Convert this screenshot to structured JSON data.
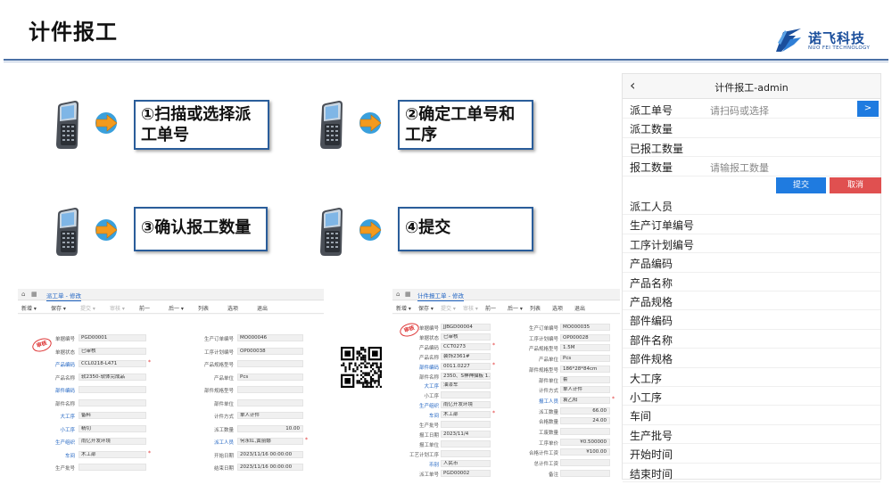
{
  "slide": {
    "title": "计件报工",
    "logo_name": "诺飞科技",
    "logo_sub": "NUO FEI TECHNOLOGY"
  },
  "steps": [
    {
      "label_line1": "①扫描或选择派",
      "label_line2": "工单号"
    },
    {
      "label_line1": "②确定工单号和",
      "label_line2": "工序"
    },
    {
      "label_line1": "③确认报工数量",
      "label_line2": ""
    },
    {
      "label_line1": "④提交",
      "label_line2": ""
    }
  ],
  "colors": {
    "accent": "#2a5d9a",
    "arrow": "#f39a1e",
    "primary_btn": "#1f7be0",
    "danger_btn": "#e05050"
  },
  "shot_left": {
    "tab": "派工单 - 修改",
    "toolbar": [
      "新增",
      "保存",
      "提交",
      "审核",
      "前一",
      "后一",
      "列表",
      "选项",
      "退出"
    ],
    "stamp": "审核",
    "left_fields": [
      {
        "label": "单据编号",
        "value": "PGD00001"
      },
      {
        "label": "单据状态",
        "value": "已审核"
      },
      {
        "label": "产品编码",
        "value": "CCL0218-L471"
      },
      {
        "label": "产品名称",
        "value": "软2350-软体完成品"
      },
      {
        "label": "部件编码",
        "value": ""
      },
      {
        "label": "部件名称",
        "value": ""
      },
      {
        "label": "大工序",
        "value": "备料"
      },
      {
        "label": "小工序",
        "value": "精切"
      },
      {
        "label": "生产组织",
        "value": "雨亿开发环境"
      },
      {
        "label": "车间",
        "value": "木工部"
      },
      {
        "label": "生产批号",
        "value": ""
      }
    ],
    "right_fields": [
      {
        "label": "生产订单编号",
        "value": "MO000046"
      },
      {
        "label": "工序计划编号",
        "value": "OP000038"
      },
      {
        "label": "产品规格型号",
        "value": ""
      },
      {
        "label": "产品单位",
        "value": "Pcs"
      },
      {
        "label": "部件规格型号",
        "value": ""
      },
      {
        "label": "部件单位",
        "value": ""
      },
      {
        "label": "计件方式",
        "value": "单人计件"
      },
      {
        "label": "派工数量",
        "value": "10.00"
      },
      {
        "label": "派工人员",
        "value": "何永红,黄丽娜"
      },
      {
        "label": "开始日期",
        "value": "2023/11/16 00:00:00"
      },
      {
        "label": "结束日期",
        "value": "2023/11/16 00:00:00"
      }
    ]
  },
  "shot_right": {
    "tab": "计件报工单 - 修改",
    "toolbar": [
      "新增",
      "保存",
      "提交",
      "审核",
      "前一",
      "后一",
      "列表",
      "选项",
      "退出"
    ],
    "stamp": "审核",
    "left_fields": [
      {
        "label": "单据编号",
        "value": "JJBGD00004"
      },
      {
        "label": "单据状态",
        "value": "已审核"
      },
      {
        "label": "产品编码",
        "value": "CCT0273"
      },
      {
        "label": "产品名称",
        "value": "装饰2361#"
      },
      {
        "label": "部件编码",
        "value": "0011.0227"
      },
      {
        "label": "部件名称",
        "value": "2350、S神神描板 1.8M"
      },
      {
        "label": "大工序",
        "value": "油漆车"
      },
      {
        "label": "小工序",
        "value": ""
      },
      {
        "label": "生产组织",
        "value": "雨亿开发环境"
      },
      {
        "label": "车间",
        "value": "木工部"
      },
      {
        "label": "生产批号",
        "value": ""
      },
      {
        "label": "报工日期",
        "value": "2023/11/4"
      },
      {
        "label": "报工单位",
        "value": ""
      },
      {
        "label": "工艺计划工序",
        "value": ""
      },
      {
        "label": "币别",
        "value": "人民币"
      },
      {
        "label": "派工单号",
        "value": "PGD00002"
      }
    ],
    "right_fields": [
      {
        "label": "生产订单编号",
        "value": "MO000035"
      },
      {
        "label": "工序计划编号",
        "value": "OP000028"
      },
      {
        "label": "产品规格型号",
        "value": "1.5M"
      },
      {
        "label": "产品单位",
        "value": "Pcs"
      },
      {
        "label": "部件规格型号",
        "value": "186*28*84cm"
      },
      {
        "label": "部件单位",
        "value": "套"
      },
      {
        "label": "计件方式",
        "value": "单人计件"
      },
      {
        "label": "报工人员",
        "value": "袁乙阳"
      },
      {
        "label": "派工数量",
        "value": "66.00"
      },
      {
        "label": "合格数量",
        "value": "24.00"
      },
      {
        "label": "工废数量",
        "value": ""
      },
      {
        "label": "工序单价",
        "value": "¥0.500000"
      },
      {
        "label": "合格计件工资",
        "value": "¥100.00"
      },
      {
        "label": "总计件工资",
        "value": ""
      },
      {
        "label": "备注",
        "value": ""
      }
    ]
  },
  "mobile": {
    "title": "计件报工-admin",
    "back": "‹",
    "rows": [
      {
        "label": "派工单号",
        "placeholder": "请扫码或选择",
        "scan": ">"
      },
      {
        "label": "派工数量",
        "placeholder": ""
      },
      {
        "label": "已报工数量",
        "placeholder": ""
      },
      {
        "label": "报工数量",
        "placeholder": "请输报工数量"
      }
    ],
    "submit": "提交",
    "cancel": "取消",
    "info_rows": [
      "派工人员",
      "生产订单编号",
      "工序计划编号",
      "产品编码",
      "产品名称",
      "产品规格",
      "部件编码",
      "部件名称",
      "部件规格",
      "大工序",
      "小工序",
      "车间",
      "生产批号",
      "开始时间",
      "结束时间"
    ]
  }
}
